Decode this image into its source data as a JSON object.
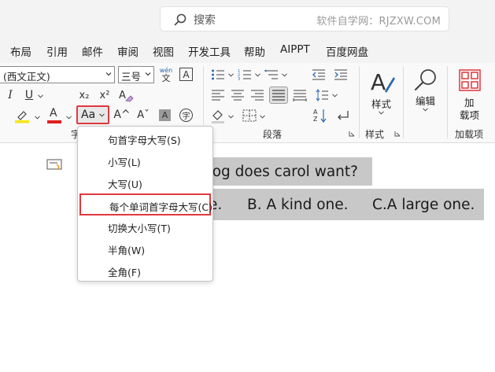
{
  "search": {
    "text": "搜索",
    "watermark": "软件自学网：RJZXW.COM"
  },
  "menu": [
    "布局",
    "引用",
    "邮件",
    "审阅",
    "视图",
    "开发工具",
    "帮助",
    "AIPPT",
    "百度网盘"
  ],
  "font": {
    "name": "(西文正文)",
    "size": "三号",
    "phonetic_top": "wén",
    "phonetic_bottom": "文",
    "border_char": "A",
    "italic": "I",
    "underline": "U",
    "subscript": "x₂",
    "superscript": "x²",
    "highlight_letter": "ab",
    "font_color_letter": "A",
    "change_case": "Aa",
    "grow_font": "A^",
    "shrink_font": "Aˇ",
    "char_shading": "A",
    "enclose_char": "字",
    "group_label_fragment": "字"
  },
  "paragraph": {
    "group_label": "段落"
  },
  "styles": {
    "button_label": "样式",
    "group_label": "样式"
  },
  "editing": {
    "button_label": "编辑"
  },
  "addins": {
    "button_label_line1": "加",
    "button_label_line2": "载项",
    "group_label": "加载项"
  },
  "document": {
    "line1": "dog does carol want?",
    "line2_a": "e.",
    "line2_b": "B. A kind one.",
    "line2_c": "C.A large one."
  },
  "dropdown": {
    "items": [
      "句首字母大写(S)",
      "小写(L)",
      "大写(U)",
      "每个单词首字母大写(C)",
      "切换大小写(T)",
      "半角(W)",
      "全角(F)"
    ],
    "selected_index": 3
  },
  "colors": {
    "highlight_yellow": "#f5e617",
    "font_red": "#e02020",
    "accent_red_border": "#e0393e",
    "selection_gray": "#c8c8c8"
  }
}
